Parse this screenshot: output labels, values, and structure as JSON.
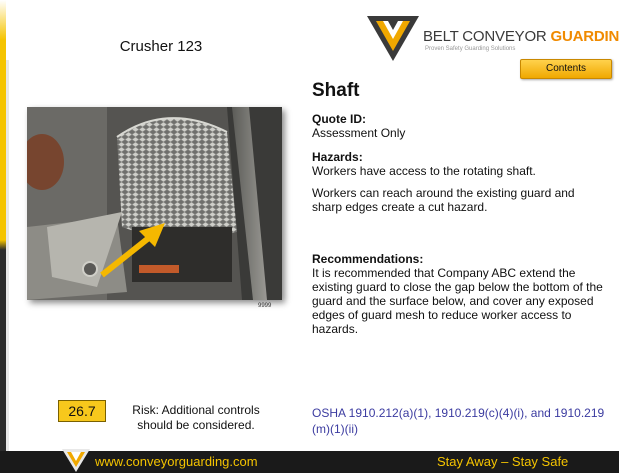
{
  "header": {
    "equipment_name": "Crusher 123",
    "brand_part1": "BELT CONVEYOR ",
    "brand_part2": "GUARDING",
    "tagline": "Proven Safety Guarding Solutions",
    "contents_label": "Contents"
  },
  "photo": {
    "id_label": "9999"
  },
  "main": {
    "title": "Shaft",
    "quote_label": "Quote ID:",
    "quote_value": "Assessment Only",
    "hazards_label": "Hazards:",
    "hazard_1": "Workers have access to the rotating shaft.",
    "hazard_2": "Workers can reach around the existing guard and sharp edges create a cut hazard.",
    "recommendations_label": "Recommendations:",
    "recommendation": "It is recommended that Company ABC extend the existing guard to close the gap below the bottom of the guard and the surface below, and cover any exposed edges of guard mesh to reduce worker access to hazards."
  },
  "risk": {
    "score": "26.7",
    "text": "Risk: Additional controls should be considered."
  },
  "osha": {
    "references": "OSHA 1910.212(a)(1), 1910.219(c)(4)(i), and 1910.219 (m)(1)(ii)"
  },
  "footer": {
    "url": "www.conveyorguarding.com",
    "slogan": "Stay Away – Stay Safe"
  },
  "colors": {
    "accent_yellow": "#f5c400",
    "brand_orange": "#f08a00",
    "link_blue": "#3b3ba0",
    "footer_bg": "#1a1a1a"
  }
}
